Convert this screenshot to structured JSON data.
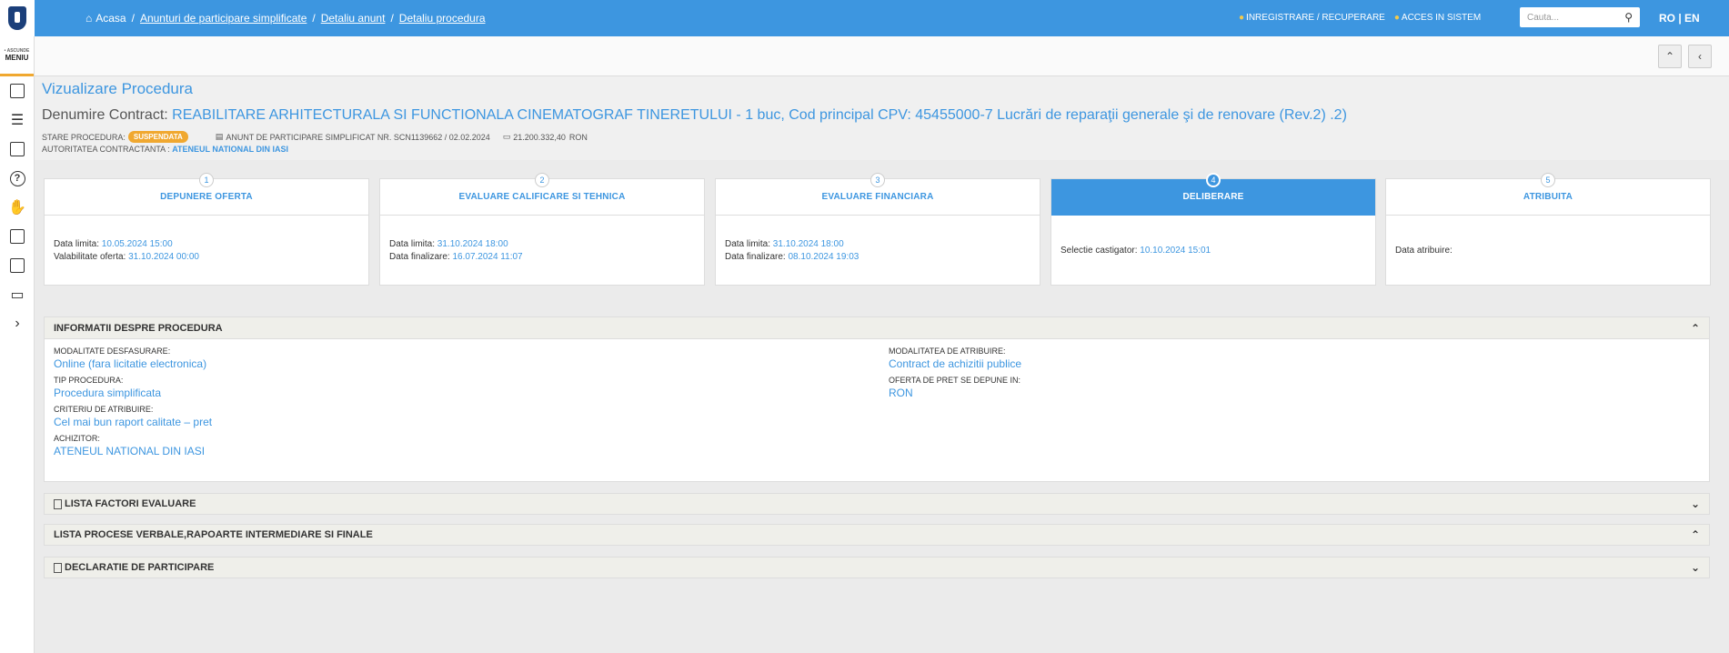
{
  "topbar": {
    "breadcrumb": [
      {
        "label": "Acasa"
      },
      {
        "label": "Anunturi de participare simplificate"
      },
      {
        "label": "Detaliu anunt"
      },
      {
        "label": "Detaliu procedura"
      }
    ],
    "register_link": "INREGISTRARE / RECUPERARE",
    "login_link": "ACCES IN SISTEM",
    "search_placeholder": "Cauta...",
    "lang": "RO | EN"
  },
  "sidebar": {
    "menu_small": "• ASCUNDE",
    "menu_label": "MENIU",
    "expand": "›"
  },
  "header": {
    "page_title": "Vizualizare Procedura",
    "contract_label": "Denumire Contract: ",
    "contract_value": "REABILITARE ARHITECTURALA SI FUNCTIONALA CINEMATOGRAF TINERETULUI - 1 buc, Cod principal CPV: 45455000-7 Lucrări de reparaţii generale şi de renovare (Rev.2) .2)",
    "state_label": "STARE PROCEDURA:",
    "state_badge": "SUSPENDATA",
    "announcement": "ANUNT DE PARTICIPARE SIMPLIFICAT NR. SCN1139662 / 02.02.2024",
    "value": "21.200.332,40",
    "currency": "RON",
    "authority_label": "AUTORITATEA CONTRACTANTA : ",
    "authority_value": "ATENEUL NATIONAL DIN IASI"
  },
  "steps": [
    {
      "num": "1",
      "title": "DEPUNERE OFERTA",
      "rows": [
        {
          "label": "Data limita: ",
          "value": "10.05.2024 15:00"
        },
        {
          "label": "Valabilitate oferta: ",
          "value": "31.10.2024 00:00"
        }
      ]
    },
    {
      "num": "2",
      "title": "EVALUARE CALIFICARE SI TEHNICA",
      "rows": [
        {
          "label": "Data limita: ",
          "value": "31.10.2024 18:00"
        },
        {
          "label": "Data finalizare: ",
          "value": "16.07.2024 11:07"
        }
      ]
    },
    {
      "num": "3",
      "title": "EVALUARE FINANCIARA",
      "rows": [
        {
          "label": "Data limita: ",
          "value": "31.10.2024 18:00"
        },
        {
          "label": "Data finalizare: ",
          "value": "08.10.2024 19:03"
        }
      ]
    },
    {
      "num": "4",
      "title": "DELIBERARE",
      "rows": [
        {
          "label": "Selectie castigator: ",
          "value": "10.10.2024 15:01"
        }
      ]
    },
    {
      "num": "5",
      "title": "ATRIBUITA",
      "rows": [
        {
          "label": "Data atribuire: ",
          "value": ""
        }
      ]
    }
  ],
  "info_panel": {
    "title": "INFORMATII DESPRE PROCEDURA",
    "left": [
      {
        "label": "MODALITATE DESFASURARE:",
        "value": "Online (fara licitatie electronica)"
      },
      {
        "label": "TIP PROCEDURA:",
        "value": "Procedura simplificata"
      },
      {
        "label": "CRITERIU DE ATRIBUIRE:",
        "value": "Cel mai bun raport calitate – pret"
      },
      {
        "label": "ACHIZITOR:",
        "value": "ATENEUL NATIONAL DIN IASI"
      }
    ],
    "right": [
      {
        "label": "MODALITATEA DE ATRIBUIRE:",
        "value": "Contract de achizitii publice"
      },
      {
        "label": "OFERTA DE PRET SE DEPUNE IN:",
        "value": "RON"
      }
    ]
  },
  "collapsed_panels": {
    "factors": "LISTA FACTORI EVALUARE",
    "verbal": "LISTA PROCESE VERBALE,RAPOARTE INTERMEDIARE SI FINALE",
    "declaration": "DECLARATIE DE PARTICIPARE"
  },
  "colors": {
    "brand": "#3d96e0",
    "badge": "#f0a830"
  }
}
